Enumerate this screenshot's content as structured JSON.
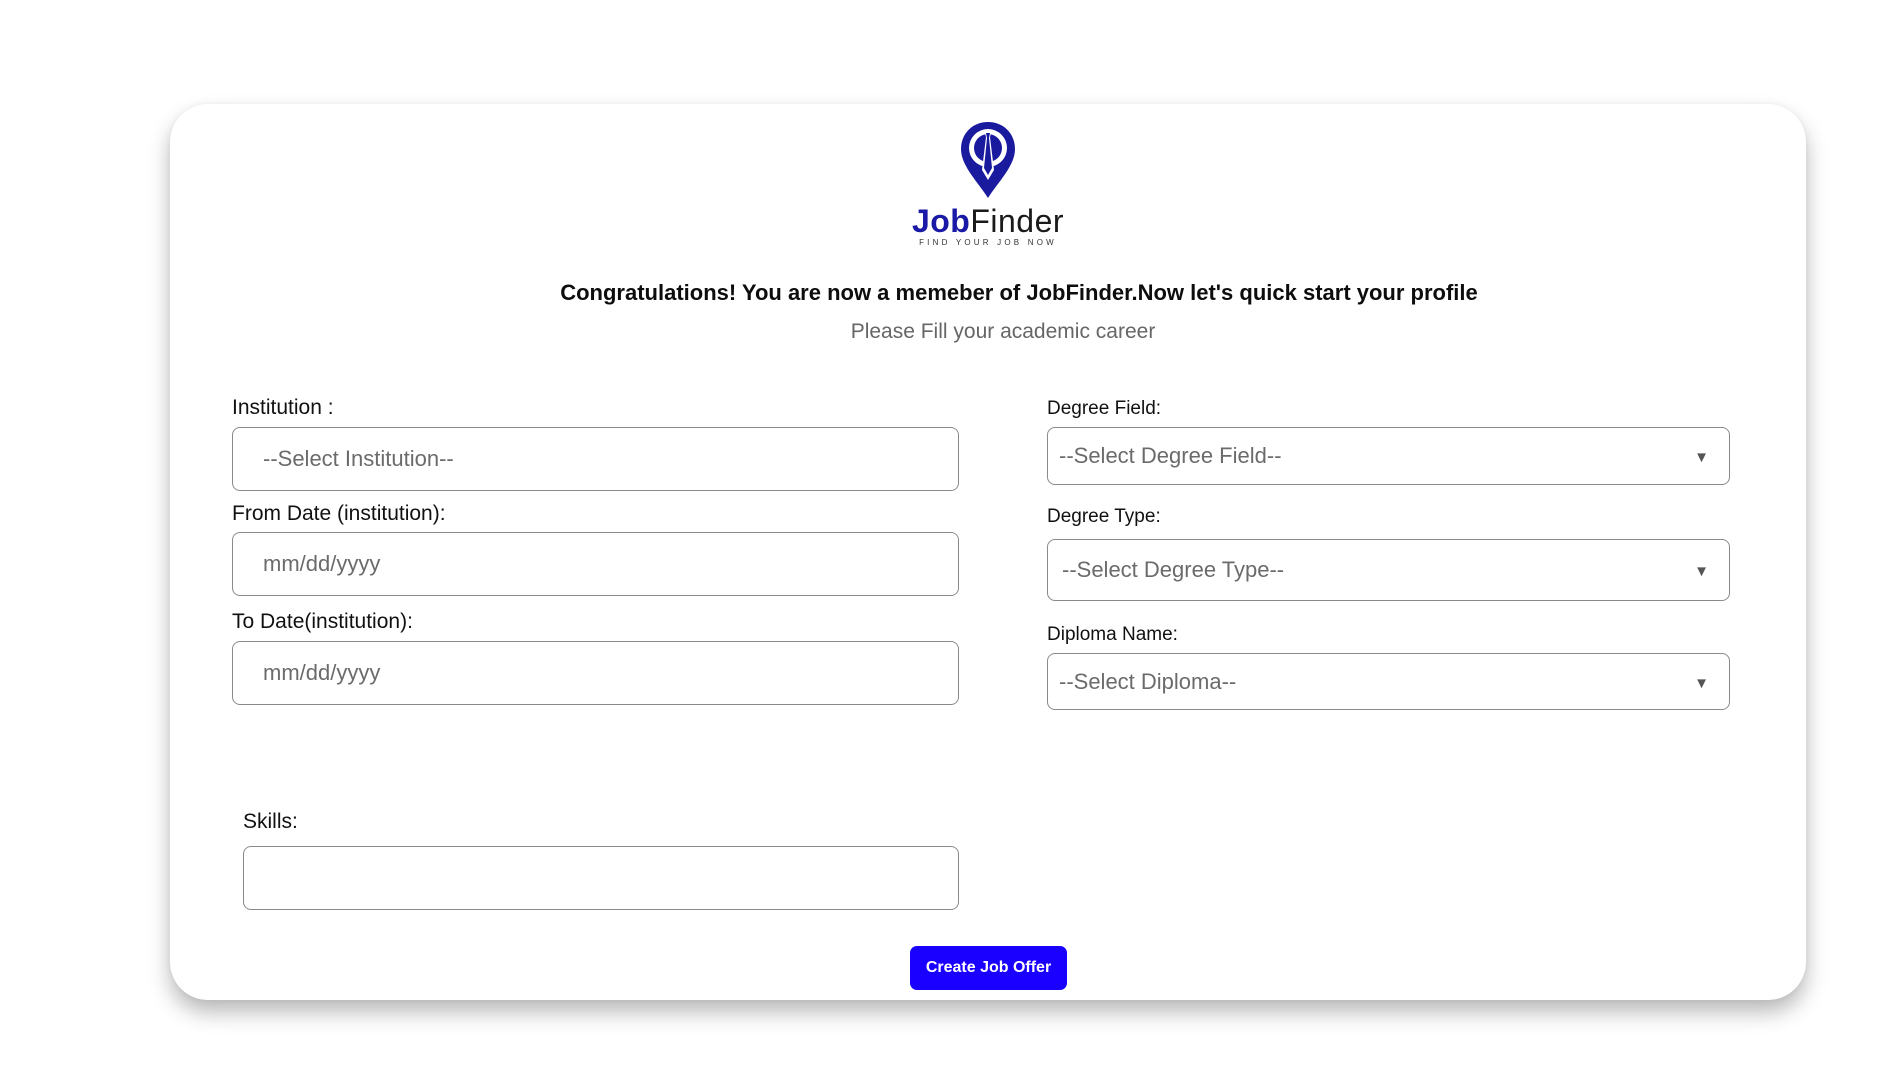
{
  "brand": {
    "name_part1": "Job",
    "name_part2": "Finder",
    "tagline": "FIND YOUR JOB NOW",
    "primary_color": "#1a1aa6"
  },
  "header": {
    "headline": "Congratulations! You are now a memeber of JobFinder.Now let's quick start your profile",
    "subline": "Please Fill your academic career"
  },
  "form": {
    "institution": {
      "label": "Institution :",
      "placeholder": "--Select Institution--"
    },
    "from_date": {
      "label": "From Date (institution):",
      "placeholder": "mm/dd/yyyy"
    },
    "to_date": {
      "label": "To Date(institution):",
      "placeholder": "mm/dd/yyyy"
    },
    "degree_field": {
      "label": "Degree Field:",
      "value": "--Select Degree Field--"
    },
    "degree_type": {
      "label": "Degree Type:",
      "value": "--Select Degree Type--"
    },
    "diploma_name": {
      "label": "Diploma Name:",
      "value": "--Select Diploma--"
    },
    "skills": {
      "label": "Skills:",
      "value": ""
    }
  },
  "actions": {
    "submit_label": "Create Job Offer",
    "submit_color": "#1a00ff"
  },
  "icons": {
    "dropdown": "chevron-down-icon",
    "logo": "location-pin-tie-icon"
  }
}
